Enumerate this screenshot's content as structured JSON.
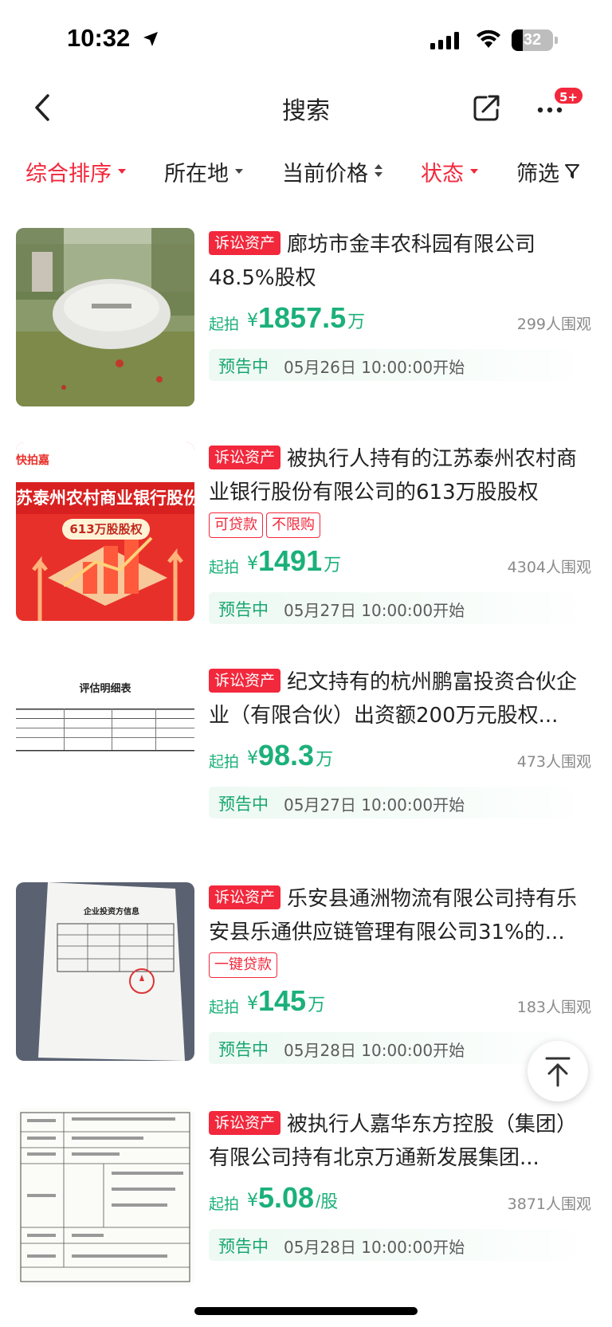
{
  "status_bar": {
    "time": "10:32",
    "battery": "32"
  },
  "nav": {
    "title": "搜索",
    "badge": "5+"
  },
  "filters": [
    {
      "label": "综合排序",
      "active": true,
      "icon": "caret-down"
    },
    {
      "label": "所在地",
      "active": false,
      "icon": "caret-down"
    },
    {
      "label": "当前价格",
      "active": false,
      "icon": "sort-arrows"
    },
    {
      "label": "状态",
      "active": true,
      "icon": "caret-down"
    },
    {
      "label": "筛选",
      "active": false,
      "icon": "funnel"
    }
  ],
  "items": [
    {
      "tag": "诉讼资产",
      "title": "廊坊市金丰农科园有限公司48.5%股权",
      "sub_tags": [],
      "price_label": "起拍",
      "currency": "¥",
      "price": "1857.5",
      "unit": "万",
      "viewers": "299人围观",
      "status": "预告中",
      "start": "05月26日 10:00:00开始"
    },
    {
      "tag": "诉讼资产",
      "title": "被执行人持有的江苏泰州农村商业银行股份有限公司的613万股股权",
      "sub_tags": [
        "可贷款",
        "不限购"
      ],
      "price_label": "起拍",
      "currency": "¥",
      "price": "1491",
      "unit": "万",
      "viewers": "4304人围观",
      "status": "预告中",
      "start": "05月27日 10:00:00开始",
      "thumb_text": {
        "logo": "快拍嘉",
        "bank": "苏泰州农村商业银行股份有限",
        "shares": "613万股股权"
      }
    },
    {
      "tag": "诉讼资产",
      "title": "纪文持有的杭州鹏富投资合伙企业（有限合伙）出资额200万元股权...",
      "sub_tags": [],
      "price_label": "起拍",
      "currency": "¥",
      "price": "98.3",
      "unit": "万",
      "viewers": "473人围观",
      "status": "预告中",
      "start": "05月27日 10:00:00开始",
      "thumb_text": {
        "heading": "评估明细表"
      }
    },
    {
      "tag": "诉讼资产",
      "title": "乐安县通洲物流有限公司持有乐安县乐通供应链管理有限公司31%的...",
      "sub_tags": [
        "一键贷款"
      ],
      "price_label": "起拍",
      "currency": "¥",
      "price": "145",
      "unit": "万",
      "viewers": "183人围观",
      "status": "预告中",
      "start": "05月28日 10:00:00开始",
      "thumb_text": {
        "heading": "企业投资方信息"
      }
    },
    {
      "tag": "诉讼资产",
      "title": "被执行人嘉华东方控股（集团）有限公司持有北京万通新发展集团...",
      "sub_tags": [],
      "price_label": "起拍",
      "currency": "¥",
      "price": "5.08",
      "unit": "/股",
      "viewers": "3871人围观",
      "status": "预告中",
      "start": "05月28日 10:00:00开始"
    }
  ],
  "colors": {
    "accent_red": "#f2283c",
    "price_green": "#1bb07a",
    "status_green": "#17a66f"
  }
}
